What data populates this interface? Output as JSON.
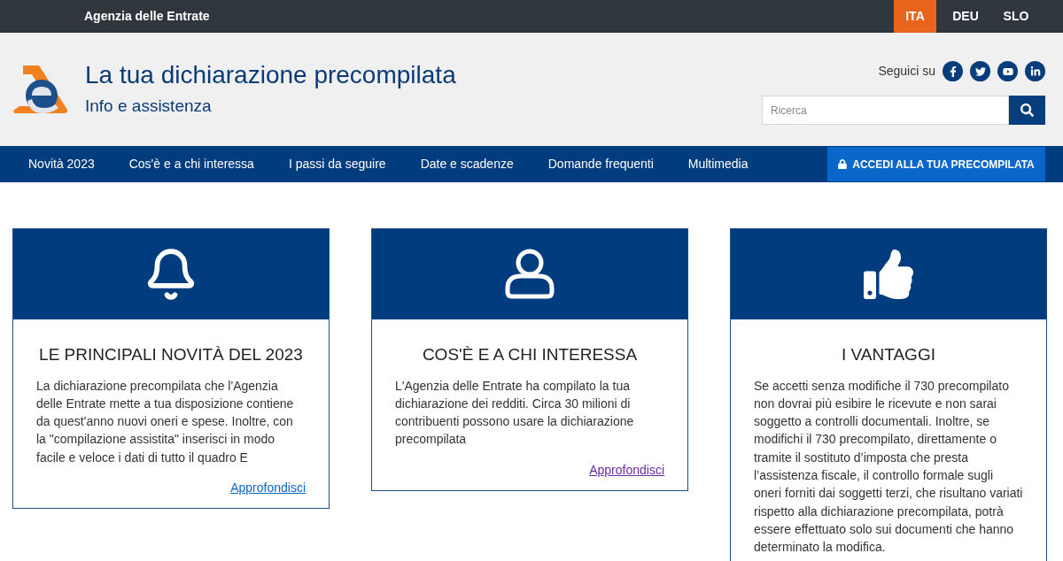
{
  "top_bar": {
    "brand": "Agenzia delle Entrate",
    "languages": [
      {
        "label": "ITA",
        "selected": true
      },
      {
        "label": "DEU",
        "selected": false
      },
      {
        "label": "SLO",
        "selected": false
      }
    ]
  },
  "header": {
    "title": "La tua dichiarazione precompilata",
    "subtitle": "Info e assistenza",
    "follow_label": "Seguici su",
    "search": {
      "placeholder": "Ricerca"
    }
  },
  "nav": {
    "items": [
      "Novità 2023",
      "Cos'è e a chi interessa",
      "I passi da seguire",
      "Date e scadenze",
      "Domande frequenti",
      "Multimedia"
    ],
    "login_button": "ACCEDI ALLA TUA PRECOMPILATA"
  },
  "cards": [
    {
      "kind": "bell",
      "title": "LE PRINCIPALI NOVITÀ DEL 2023",
      "text": "La dichiarazione precompilata che l'Agenzia delle Entrate mette a tua disposizione contiene da quest'anno nuovi oneri e spese. Inoltre, con la \"compilazione assistita\" inserisci in modo facile e veloce i dati di tutto il quadro E",
      "link": {
        "label": "Approfondisci",
        "visited": false
      }
    },
    {
      "kind": "user",
      "title": "COS'È E A CHI INTERESSA",
      "text": "L'Agenzia delle Entrate ha compilato la tua dichiarazione dei redditi. Circa 30 milioni di contribuenti possono usare la dichiarazione precompilata",
      "link": {
        "label": "Approfondisci",
        "visited": true
      }
    },
    {
      "kind": "thumb",
      "title": "I VANTAGGI",
      "text": "Se accetti senza modifiche il 730 precompilato non dovrai più esibire le ricevute e non sarai soggetto a controlli documentali. Inoltre, se modifichi il 730 precompilato, direttamente o tramite il sostituto d’imposta che presta l’assistenza fiscale, il controllo formale sugli oneri forniti dai soggetti terzi, che risultano variati rispetto alla dichiarazione precompilata, potrà essere effettuato solo sui documenti che hanno determinato la modifica."
    }
  ]
}
